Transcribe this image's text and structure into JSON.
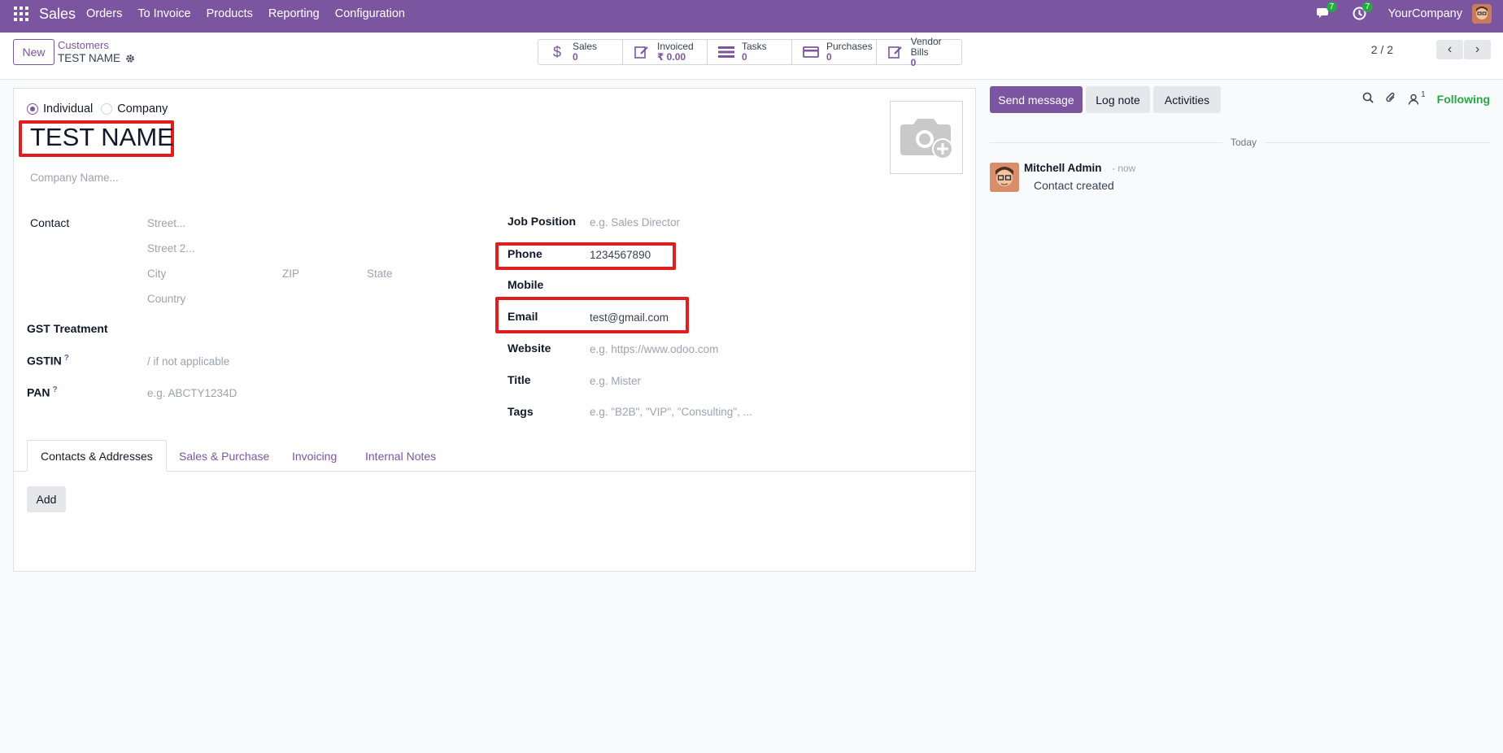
{
  "topnav": {
    "app": "Sales",
    "menu": [
      "Orders",
      "To Invoice",
      "Products",
      "Reporting",
      "Configuration"
    ],
    "messages_badge": "7",
    "activities_badge": "7",
    "company": "YourCompany"
  },
  "control": {
    "new_label": "New",
    "breadcrumb_parent": "Customers",
    "breadcrumb_current": "TEST NAME",
    "stats": [
      {
        "label": "Sales",
        "value": "0",
        "icon": "dollar-icon"
      },
      {
        "label": "Invoiced",
        "value": "₹ 0.00",
        "icon": "edit-icon"
      },
      {
        "label": "Tasks",
        "value": "0",
        "icon": "tasks-icon"
      },
      {
        "label": "Purchases",
        "value": "0",
        "icon": "credit-card-icon"
      },
      {
        "label": "Vendor Bills",
        "value": "0",
        "icon": "edit-icon"
      }
    ],
    "pager": "2 / 2"
  },
  "form": {
    "type_options": [
      "Individual",
      "Company"
    ],
    "selected_type": "Individual",
    "name": "TEST NAME",
    "company_name_placeholder": "Company Name...",
    "contact_label": "Contact",
    "street_placeholder": "Street...",
    "street2_placeholder": "Street 2...",
    "city_placeholder": "City",
    "zip_placeholder": "ZIP",
    "state_placeholder": "State",
    "country_placeholder": "Country",
    "gst_treatment_label": "GST Treatment",
    "gstin_label": "GSTIN",
    "gstin_help": "?",
    "gstin_placeholder": "/ if not applicable",
    "pan_label": "PAN",
    "pan_help": "?",
    "pan_placeholder": "e.g. ABCTY1234D",
    "job_position_label": "Job Position",
    "job_position_placeholder": "e.g. Sales Director",
    "phone_label": "Phone",
    "phone_value": "1234567890",
    "mobile_label": "Mobile",
    "email_label": "Email",
    "email_value": "test@gmail.com",
    "website_label": "Website",
    "website_placeholder": "e.g. https://www.odoo.com",
    "title_label": "Title",
    "title_placeholder": "e.g. Mister",
    "tags_label": "Tags",
    "tags_placeholder": "e.g. \"B2B\", \"VIP\", \"Consulting\", ..."
  },
  "tabs": [
    "Contacts & Addresses",
    "Sales & Purchase",
    "Invoicing",
    "Internal Notes"
  ],
  "active_tab": "Contacts & Addresses",
  "add_label": "Add",
  "chatter": {
    "send_message": "Send message",
    "log_note": "Log note",
    "activities": "Activities",
    "followers_count": "1",
    "following": "Following",
    "date_separator": "Today",
    "message": {
      "author": "Mitchell Admin",
      "time": "- now",
      "body": "Contact created"
    }
  },
  "colors": {
    "brand": "#7c55a0",
    "highlight": "#e11d1d",
    "following": "#28a745"
  }
}
